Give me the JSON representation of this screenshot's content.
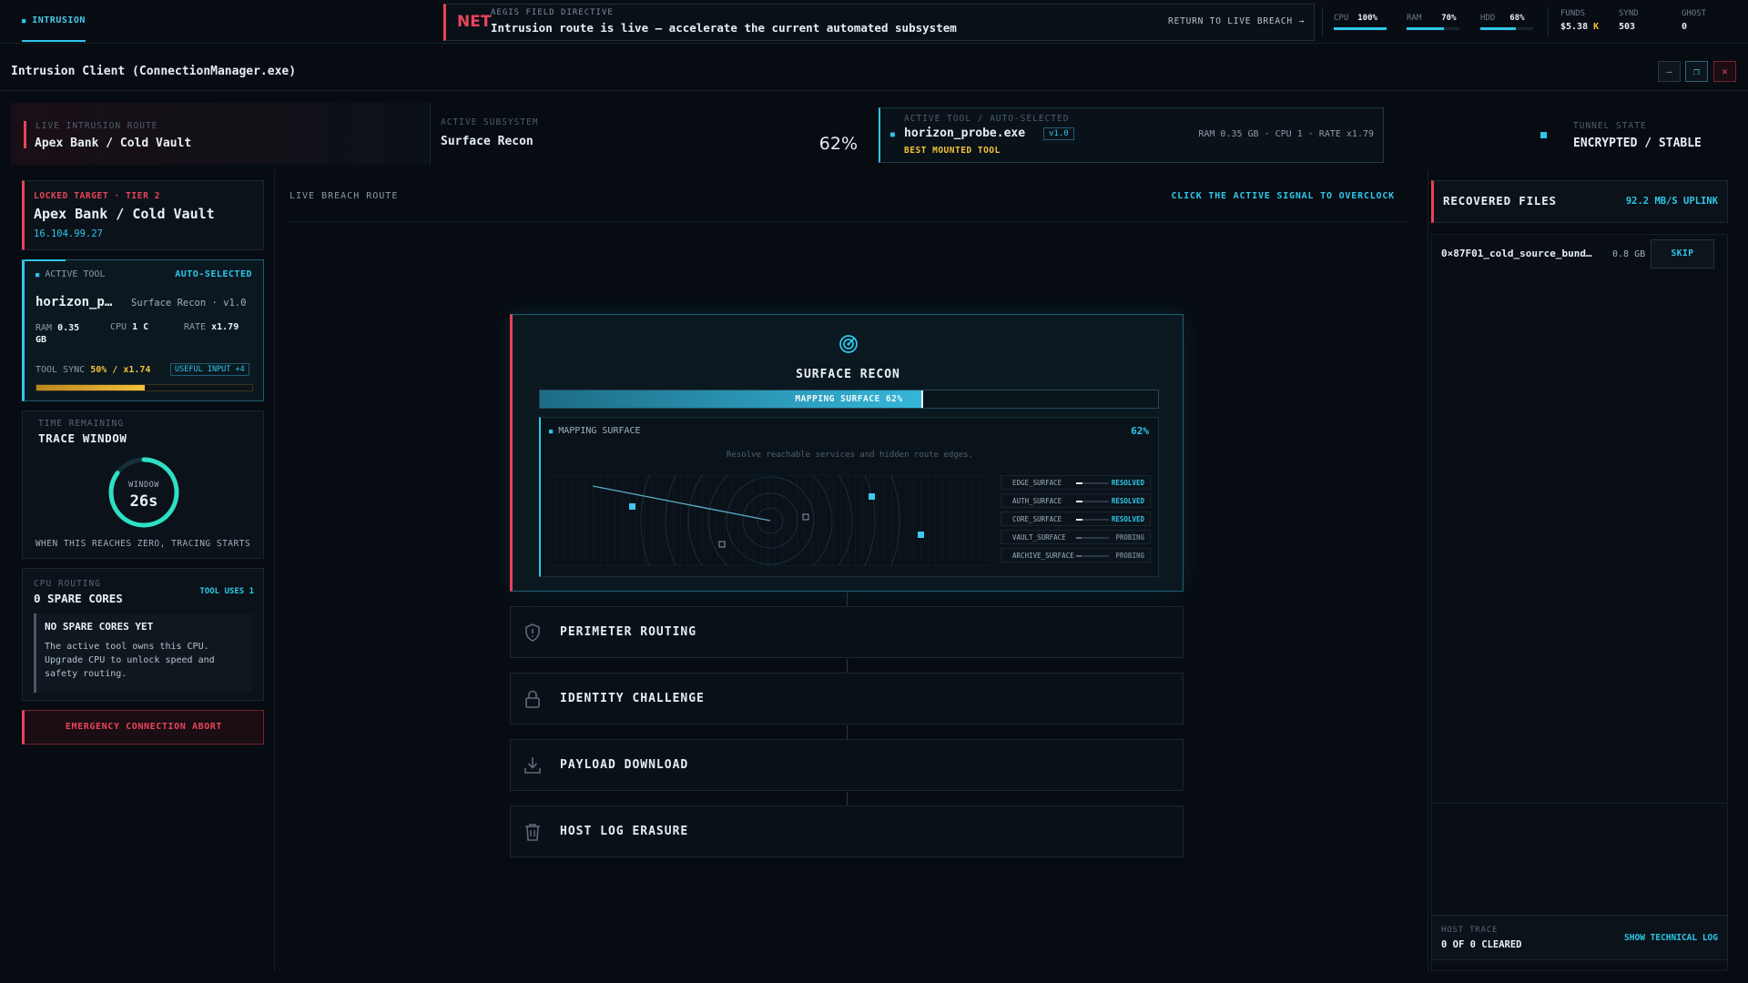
{
  "topbar": {
    "tab": "INTRUSION",
    "net_badge": "NET",
    "directive_kicker": "AEGIS FIELD DIRECTIVE",
    "directive_msg": "Intrusion route is live — accelerate the current automated subsystem",
    "return_label": "RETURN TO LIVE BREACH →",
    "cpu": {
      "label": "CPU",
      "value": "100%",
      "level": 1.0
    },
    "ram": {
      "label": "RAM",
      "value": "70%",
      "level": 0.7
    },
    "hdd": {
      "label": "HDD",
      "value": "68%",
      "level": 0.68
    },
    "funds": {
      "label": "FUNDS",
      "value": "$5.38",
      "unit": "K"
    },
    "synd": {
      "label": "SYND",
      "value": "503"
    },
    "ghost": {
      "label": "GHOST",
      "value": "0"
    }
  },
  "window": {
    "title": "Intrusion Client (ConnectionManager.exe)",
    "min": "—",
    "max": "❐",
    "close": "✕"
  },
  "strip": {
    "route_label": "LIVE INTRUSION ROUTE",
    "route_value": "Apex Bank / Cold Vault",
    "subsys_label": "ACTIVE SUBSYSTEM",
    "subsys_value": "Surface Recon",
    "subsys_pct": "62%",
    "tool_label": "ACTIVE TOOL / AUTO-SELECTED",
    "tool_name": "horizon_probe.exe",
    "tool_version": "v1.0",
    "tool_tag": "BEST MOUNTED TOOL",
    "tool_stats": "RAM 0.35 GB · CPU 1 · RATE x1.79",
    "tunnel_label": "TUNNEL STATE",
    "tunnel_value": "ENCRYPTED / STABLE"
  },
  "target": {
    "kicker": "LOCKED TARGET · TIER 2",
    "name": "Apex Bank / Cold Vault",
    "ip": "16.104.99.27"
  },
  "active_tool": {
    "label": "ACTIVE TOOL",
    "auto": "AUTO-SELECTED",
    "name": "horizon_p…",
    "desc": "Surface Recon · v1.0",
    "ram_label": "RAM",
    "ram_val": "0.35",
    "ram_unit": "GB",
    "cpu_label": "CPU",
    "cpu_val": "1 C",
    "rate_label": "RATE",
    "rate_val": "x1.79",
    "sync_label": "TOOL SYNC",
    "sync_val": "50% / x1.74",
    "useful": "USEFUL INPUT +4",
    "sync_level": 0.5
  },
  "trace": {
    "kicker": "TIME REMAINING",
    "title": "TRACE WINDOW",
    "ring_label": "WINDOW",
    "ring_value": "26s",
    "ring_level": 0.85,
    "note": "WHEN THIS REACHES ZERO, TRACING STARTS"
  },
  "cpu_routing": {
    "kicker": "CPU ROUTING",
    "title": "0 SPARE CORES",
    "uses": "TOOL USES 1",
    "box_title": "NO SPARE CORES YET",
    "box_text": "The active tool owns this CPU. Upgrade CPU to unlock speed and safety routing."
  },
  "abort_label": "EMERGENCY CONNECTION ABORT",
  "center": {
    "route_label": "LIVE BREACH ROUTE",
    "overclock_hint": "CLICK THE ACTIVE SIGNAL TO OVERCLOCK",
    "recon_title": "SURFACE RECON",
    "progress_label": "MAPPING SURFACE 62%",
    "progress_level": 0.62,
    "panel_label": "MAPPING SURFACE",
    "panel_pct": "62%",
    "panel_hint": "Resolve reachable services and hidden route edges.",
    "surfaces": [
      {
        "name": "EDGE_SURFACE",
        "status": "RESOLVED"
      },
      {
        "name": "AUTH_SURFACE",
        "status": "RESOLVED"
      },
      {
        "name": "CORE_SURFACE",
        "status": "RESOLVED"
      },
      {
        "name": "VAULT_SURFACE",
        "status": "PROBING"
      },
      {
        "name": "ARCHIVE_SURFACE",
        "status": "PROBING"
      }
    ],
    "stages": [
      {
        "label": "PERIMETER ROUTING",
        "icon": "shield-icon"
      },
      {
        "label": "IDENTITY CHALLENGE",
        "icon": "lock-icon"
      },
      {
        "label": "PAYLOAD DOWNLOAD",
        "icon": "download-icon"
      },
      {
        "label": "HOST LOG ERASURE",
        "icon": "trash-icon"
      }
    ]
  },
  "recovered": {
    "title": "RECOVERED FILES",
    "uplink": "92.2 MB/S UPLINK",
    "file_name": "0×87F01_cold_source_bund…",
    "file_size": "0.8 GB",
    "skip": "SKIP"
  },
  "host_trace": {
    "label": "HOST TRACE",
    "value": "0 OF 0 CLEARED",
    "link": "SHOW TECHNICAL LOG"
  },
  "colors": {
    "accent": "#2ec7ea",
    "alert": "#e8445a",
    "warn": "#f2c23a",
    "bg": "#070c12"
  }
}
